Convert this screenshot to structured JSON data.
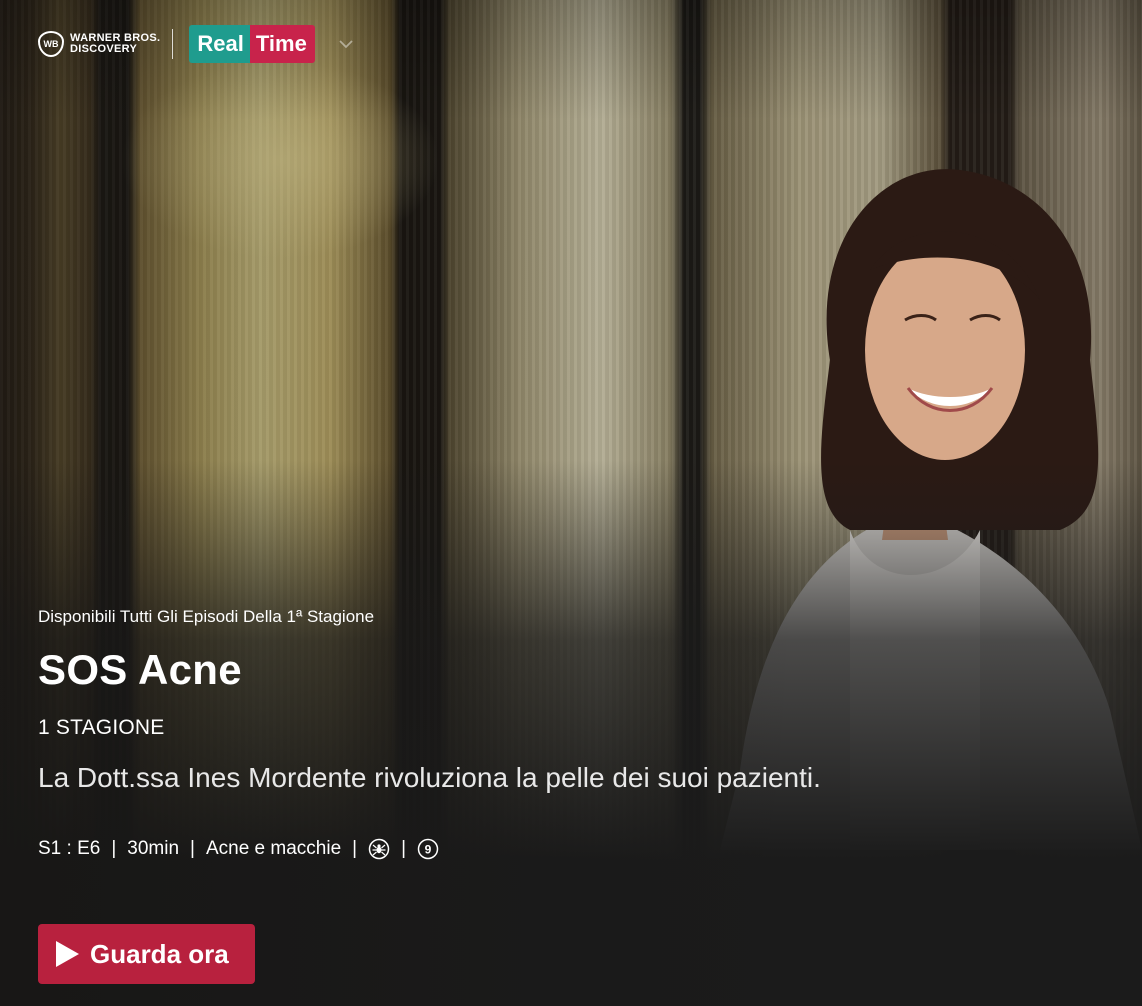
{
  "header": {
    "brand_top": "WARNER BROS.",
    "brand_bottom": "DISCOVERY",
    "channel_left": "Real",
    "channel_right": "Time",
    "dropdown_icon": "chevron-down-icon"
  },
  "show": {
    "supertitle": "Disponibili Tutti Gli Episodi Della 1ª Stagione",
    "title": "SOS Acne",
    "seasons": "1 STAGIONE",
    "description": "La Dott.ssa Ines Mordente rivoluziona la pelle dei suoi pazienti.",
    "meta": {
      "episode": "S1 : E6",
      "duration": "30min",
      "genre": "Acne e macchie",
      "separator": "|",
      "content_icon": "spider-icon",
      "age_rating": "9"
    }
  },
  "cta": {
    "label": "Guarda ora",
    "icon": "play-icon"
  },
  "colors": {
    "cta": "#b8213e",
    "real_time_green": "#1f9c8e",
    "real_time_red": "#c8234b",
    "background": "#1b1b1b"
  }
}
